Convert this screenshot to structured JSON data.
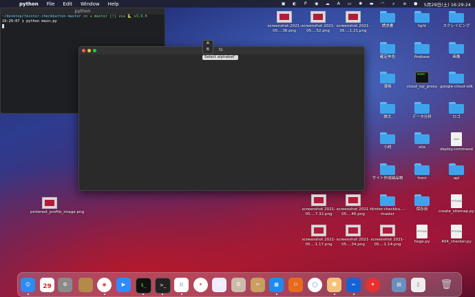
{
  "menubar": {
    "app_name": "python",
    "menus": [
      "File",
      "Edit",
      "Window",
      "Help"
    ],
    "datetime": "5月29日(土) 16:29:24"
  },
  "terminal": {
    "title": "python",
    "line1_path": "~/desktop/tkinter-checkbutton-master",
    "line1_on": "on",
    "line1_branch": "✷ master [!] via 🐍 v3.9.0",
    "line2": "16:29:07 ❯ python main.py"
  },
  "tk_window": {
    "title": "tk",
    "menu_items": [
      "A",
      "B"
    ],
    "option_menu_label": "Select alphabet",
    "option_menu_chevron": "⌃"
  },
  "desktop_icons": [
    {
      "label": "screenshot 2021-05....36.png",
      "kind": "thumb"
    },
    {
      "label": "screenshot 2021-05....52.png",
      "kind": "thumb"
    },
    {
      "label": "screenshot 2021-05....1.21.png",
      "kind": "thumb"
    },
    {
      "label": "請求書",
      "kind": "folder"
    },
    {
      "label": "light",
      "kind": "folder"
    },
    {
      "label": "スクレイピング",
      "kind": "folder"
    },
    {
      "label": "確定申告",
      "kind": "folder"
    },
    {
      "label": "firebase",
      "kind": "folder"
    },
    {
      "label": "画像",
      "kind": "folder"
    },
    {
      "label": "漫画",
      "kind": "folder"
    },
    {
      "label": "cloud_sql_proxy",
      "kind": "terminal"
    },
    {
      "label": "google-cloud-sdk",
      "kind": "folder"
    },
    {
      "label": "論文",
      "kind": "folder"
    },
    {
      "label": "データ分析",
      "kind": "folder"
    },
    {
      "label": "ロゴ",
      "kind": "folder"
    },
    {
      "label": "小説",
      "kind": "folder"
    },
    {
      "label": "site",
      "kind": "folder"
    },
    {
      "label": "deploy.command",
      "kind": "doc"
    },
    {
      "label": "サイト作成納品物",
      "kind": "folder"
    },
    {
      "label": "front",
      "kind": "folder"
    },
    {
      "label": "api",
      "kind": "folder"
    },
    {
      "label": "screenshot 2021-05....7.32.png",
      "kind": "thumb"
    },
    {
      "label": "screenshot 2021-05....46.png",
      "kind": "thumb"
    },
    {
      "label": "tkinter-checkbu...-master",
      "kind": "folder"
    },
    {
      "label": "保存用",
      "kind": "folder"
    },
    {
      "label": "create_sitemap.py",
      "kind": "doc"
    },
    {
      "label": "screenshot 2021-05....1.17.png",
      "kind": "thumb"
    },
    {
      "label": "screenshot 2021-05....34.png",
      "kind": "thumb"
    },
    {
      "label": "screenshot 2021-05....1.14.png",
      "kind": "thumb"
    },
    {
      "label": "hoge.py",
      "kind": "doc"
    },
    {
      "label": "404_checker.py",
      "kind": "doc"
    },
    {
      "label": "pinterest_profile_image.png",
      "kind": "thumb"
    }
  ],
  "doc_badges": {
    "python": "PYTHON",
    "exec": "exec",
    "shell": "shell"
  },
  "dock": {
    "calendar_day": "29",
    "calendar_month": "MAY"
  }
}
